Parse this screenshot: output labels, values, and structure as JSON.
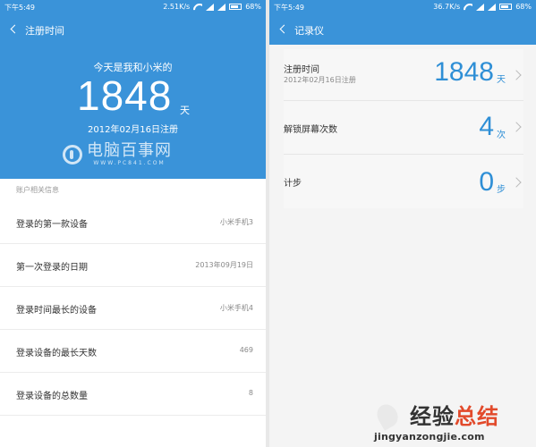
{
  "left": {
    "status": {
      "time": "下午5:49",
      "speed": "2.51K/s",
      "battery": "68%"
    },
    "title": "注册时间",
    "hero": {
      "subtitle": "今天是我和小米的",
      "days": "1848",
      "unit": "天",
      "date": "2012年02月16日注册"
    },
    "watermark": {
      "text": "电脑百事网",
      "url": "WWW.PC841.COM"
    },
    "section_label": "账户相关信息",
    "rows": [
      {
        "label": "登录的第一款设备",
        "value": "小米手机3"
      },
      {
        "label": "第一次登录的日期",
        "value": "2013年09月19日"
      },
      {
        "label": "登录时间最长的设备",
        "value": "小米手机4"
      },
      {
        "label": "登录设备的最长天数",
        "value": "469"
      },
      {
        "label": "登录设备的总数量",
        "value": "8"
      }
    ]
  },
  "right": {
    "status": {
      "time": "下午5:49",
      "speed": "36.7K/s",
      "battery": "68%"
    },
    "title": "记录仪",
    "items": [
      {
        "label": "注册时间",
        "sub": "2012年02月16日注册",
        "number": "1848",
        "unit": "天"
      },
      {
        "label": "解锁屏幕次数",
        "number": "4",
        "unit": "次"
      },
      {
        "label": "计步",
        "number": "0",
        "unit": "步"
      }
    ]
  },
  "watermark2": {
    "cn_a": "经验",
    "cn_b": "总结",
    "url": "jingyanzongjie.com"
  },
  "colors": {
    "accent": "#3a93d9",
    "number": "#2f8fd6"
  }
}
